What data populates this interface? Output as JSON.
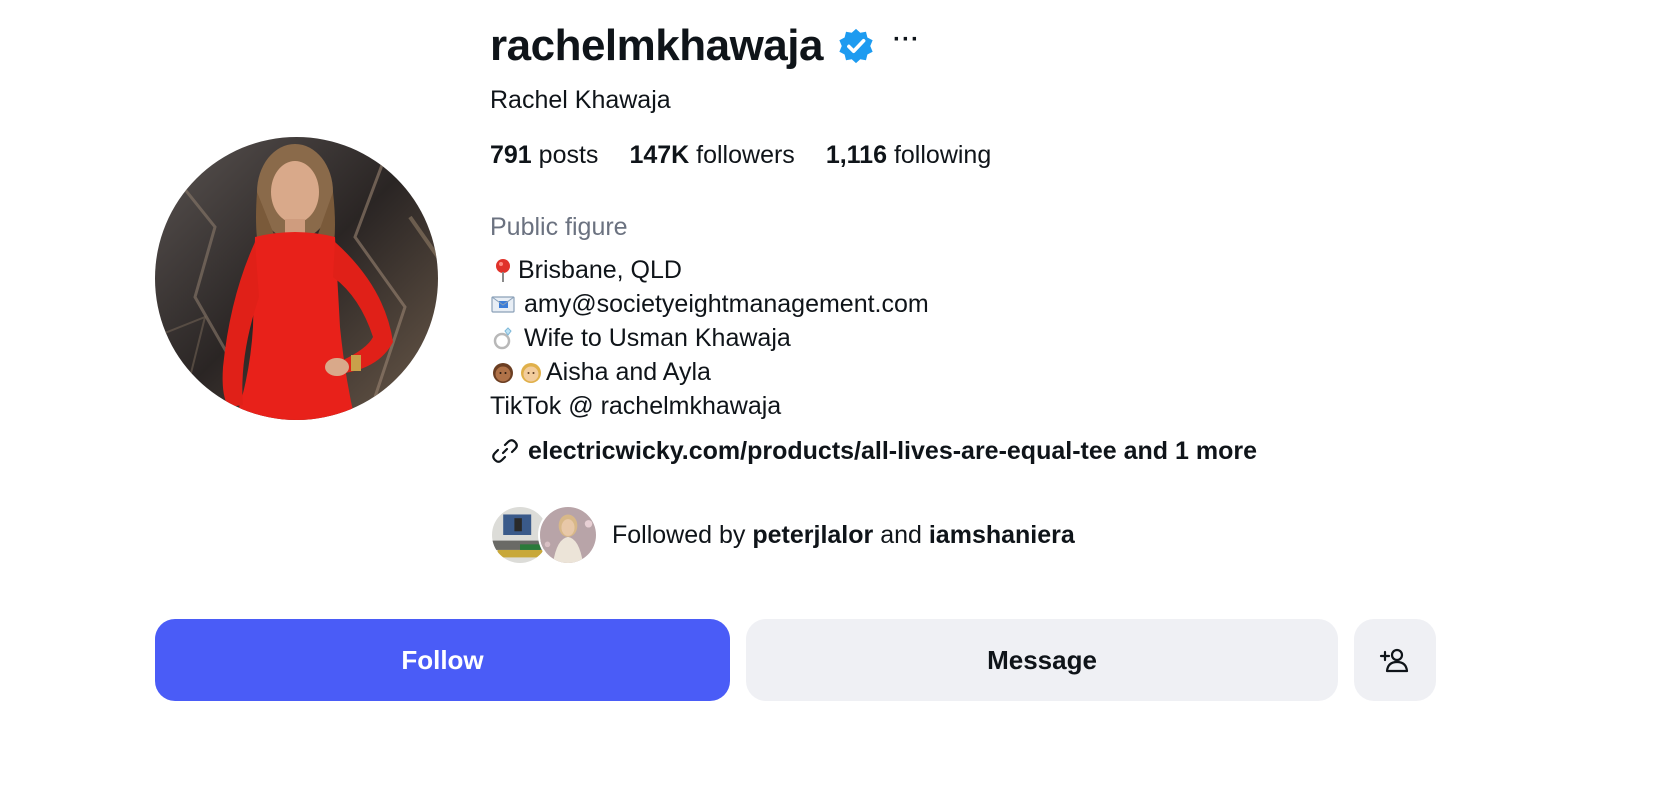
{
  "profile": {
    "username": "rachelmkhawaja",
    "full_name": "Rachel Khawaja",
    "verified": true,
    "more_label": "···"
  },
  "stats": {
    "posts_count": "791",
    "posts_label": "posts",
    "followers_count": "147K",
    "followers_label": "followers",
    "following_count": "1,116",
    "following_label": "following"
  },
  "category": "Public figure",
  "bio": {
    "location": "Brisbane, QLD",
    "email": "amy@societyeightmanagement.com",
    "spouse": "Wife to Usman Khawaja",
    "kids": "Aisha and Ayla",
    "tiktok": "TikTok @ rachelmkhawaja"
  },
  "link": {
    "url_text": "electricwicky.com/products/all-lives-are-equal-tee",
    "more_text": "and 1 more"
  },
  "followed_by": {
    "prefix": "Followed by",
    "user1": "peterjlalor",
    "connector": "and",
    "user2": "iamshaniera"
  },
  "actions": {
    "follow_label": "Follow",
    "message_label": "Message"
  },
  "colors": {
    "follow_bg": "#4a5cf7",
    "secondary_bg": "#eff0f4",
    "verified": "#1d9bf0",
    "muted_text": "#6b7280"
  }
}
